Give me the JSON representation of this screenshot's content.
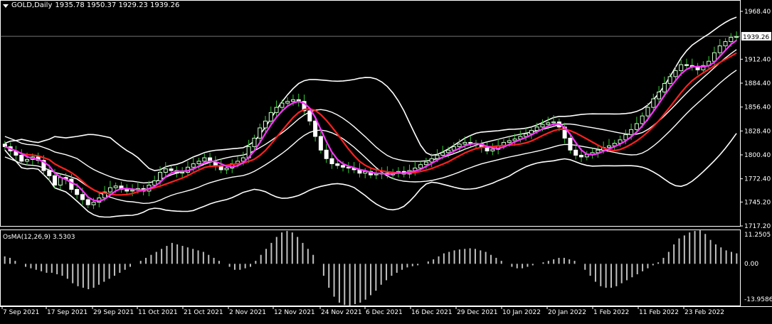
{
  "header": {
    "symbol": "GOLD,Daily",
    "ohlc": "1935.78 1950.37 1929.23 1939.26"
  },
  "osma": {
    "label": "OsMA(12,26,9) 3.5303",
    "axis_labels": [
      "11.2505",
      "0.00",
      "-13.9586"
    ]
  },
  "price_axis": {
    "labels": [
      "1968.40",
      "1939.26",
      "1912.40",
      "1884.40",
      "1856.40",
      "1828.40",
      "1800.40",
      "1772.40",
      "1745.20",
      "1717.20"
    ],
    "current_price": "1939.26"
  },
  "time_axis": {
    "labels": [
      "7 Sep 2021",
      "17 Sep 2021",
      "29 Sep 2021",
      "11 Oct 2021",
      "21 Oct 2021",
      "2 Nov 2021",
      "12 Nov 2021",
      "24 Nov 2021",
      "6 Dec 2021",
      "16 Dec 2021",
      "29 Dec 2021",
      "10 Jan 2022",
      "20 Jan 2022",
      "1 Feb 2022",
      "11 Feb 2022",
      "23 Feb 2022"
    ]
  },
  "colors": {
    "background": "#000000",
    "grid": "#ffffff",
    "candle_up": "#ccffcc",
    "candle_down": "#ffffff",
    "wick": "#33cc33",
    "ma_fast": "#ff33ff",
    "ma_slow": "#ff2020",
    "bands": "#ffffff",
    "histogram": "#c0c0c0"
  },
  "chart_data": {
    "type": "candlestick",
    "symbol": "GOLD",
    "timeframe": "Daily",
    "yrange": [
      1717.2,
      1968.4
    ],
    "closes": [
      1810,
      1805,
      1800,
      1793,
      1795,
      1798,
      1794,
      1782,
      1776,
      1765,
      1774,
      1772,
      1760,
      1754,
      1748,
      1742,
      1745,
      1750,
      1757,
      1762,
      1764,
      1760,
      1758,
      1759,
      1761,
      1758,
      1765,
      1770,
      1780,
      1784,
      1782,
      1779,
      1780,
      1786,
      1790,
      1793,
      1797,
      1792,
      1788,
      1783,
      1785,
      1790,
      1793,
      1797,
      1810,
      1820,
      1832,
      1840,
      1850,
      1856,
      1861,
      1863,
      1865,
      1863,
      1852,
      1840,
      1822,
      1806,
      1796,
      1790,
      1788,
      1786,
      1785,
      1783,
      1779,
      1781,
      1777,
      1778,
      1779,
      1777,
      1780,
      1781,
      1778,
      1782,
      1785,
      1789,
      1792,
      1796,
      1800,
      1803,
      1806,
      1810,
      1813,
      1815,
      1814,
      1813,
      1809,
      1805,
      1807,
      1811,
      1815,
      1817,
      1819,
      1822,
      1825,
      1829,
      1833,
      1836,
      1838,
      1839,
      1833,
      1820,
      1806,
      1800,
      1798,
      1801,
      1803,
      1806,
      1809,
      1811,
      1814,
      1818,
      1824,
      1830,
      1837,
      1846,
      1856,
      1866,
      1874,
      1884,
      1892,
      1899,
      1906,
      1905,
      1904,
      1900,
      1905,
      1910,
      1920,
      1928,
      1933,
      1938,
      1939
    ],
    "series": [],
    "osma": [
      2.5,
      2.0,
      1.0,
      0.0,
      -1.0,
      -1.5,
      -2.0,
      -2.5,
      -3.0,
      -3.0,
      -3.5,
      -4.0,
      -5.0,
      -6.5,
      -7.5,
      -8.0,
      -8.5,
      -8.0,
      -7.0,
      -6.0,
      -5.0,
      -4.0,
      -3.0,
      -2.0,
      -1.0,
      0.0,
      1.0,
      2.0,
      3.0,
      4.0,
      5.0,
      6.0,
      7.0,
      6.5,
      6.0,
      5.5,
      5.0,
      4.5,
      4.0,
      3.0,
      2.0,
      1.0,
      0.0,
      -1.0,
      -2.0,
      -2.0,
      -1.5,
      -1.0,
      1.0,
      3.0,
      5.0,
      7.0,
      9.0,
      10.5,
      11.0,
      10.5,
      9.0,
      7.0,
      5.0,
      3.0,
      0.0,
      -4.0,
      -8.0,
      -11.0,
      -13.0,
      -13.8,
      -14.0,
      -13.5,
      -13.0,
      -12.0,
      -10.5,
      -9.0,
      -7.0,
      -5.5,
      -4.0,
      -3.0,
      -2.0,
      -1.2,
      -0.8,
      -0.5,
      0.0,
      0.8,
      1.5,
      2.5,
      3.5,
      4.0,
      4.5,
      4.8,
      5.0,
      5.2,
      5.0,
      4.5,
      4.0,
      3.0,
      2.0,
      1.0,
      0.0,
      -1.0,
      -1.5,
      -1.5,
      -1.0,
      -0.5,
      0.0,
      0.5,
      1.0,
      1.5,
      2.0,
      2.0,
      1.5,
      1.0,
      0.0,
      -2.0,
      -4.0,
      -6.0,
      -7.5,
      -8.0,
      -8.0,
      -7.5,
      -6.5,
      -5.5,
      -4.5,
      -3.5,
      -2.5,
      -1.5,
      -0.5,
      0.5,
      2.0,
      4.0,
      6.5,
      8.5,
      9.5,
      10.5,
      11.0,
      11.2,
      10.0,
      8.0,
      6.5,
      5.5,
      4.5,
      4.0,
      3.5
    ],
    "indicators": [
      "Moving Average (fast)",
      "Moving Average (slow)",
      "Bollinger Bands",
      "Envelope",
      "OsMA(12,26,9)"
    ]
  }
}
